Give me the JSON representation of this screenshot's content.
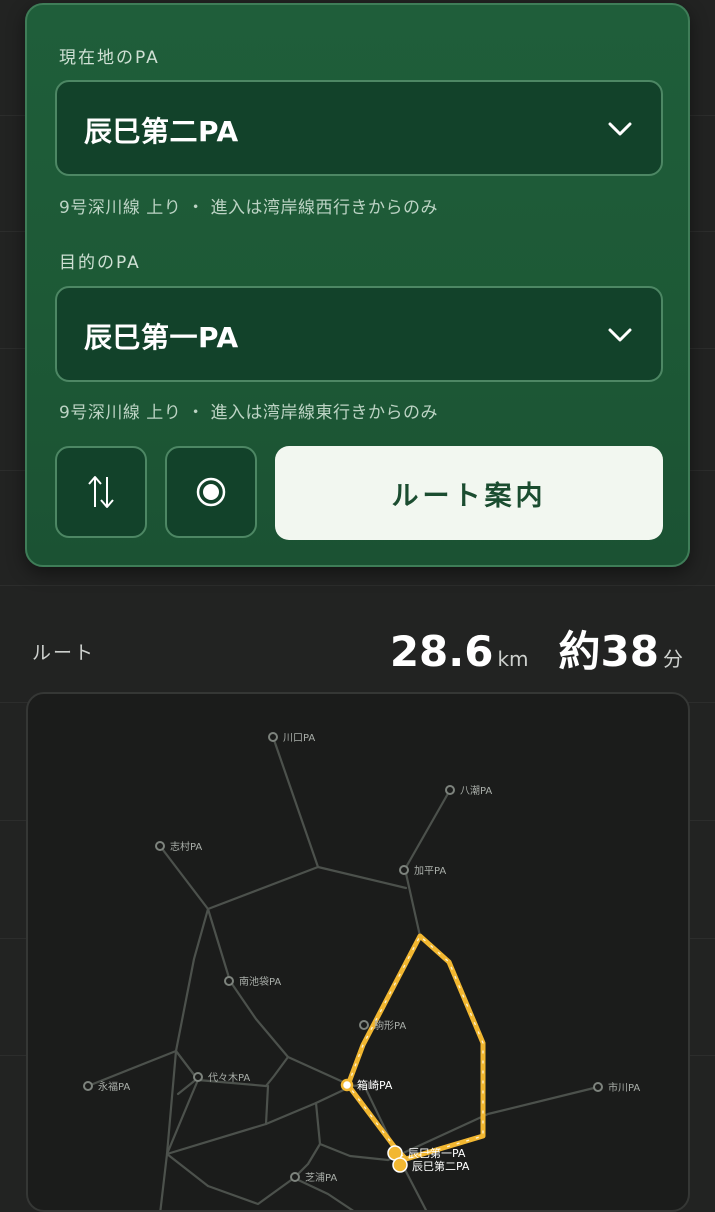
{
  "origin": {
    "label": "現在地のPA",
    "value": "辰巳第二PA",
    "hint": "9号深川線 上り ・ 進入は湾岸線西行きからのみ"
  },
  "destination": {
    "label": "目的のPA",
    "value": "辰巳第一PA",
    "hint": "9号深川線 上り ・ 進入は湾岸線東行きからのみ"
  },
  "actions": {
    "swap_icon": "swap-vertical-icon",
    "locate_icon": "current-location-icon",
    "route_label": "ルート案内"
  },
  "summary": {
    "label": "ルート",
    "distance": "28.6",
    "distance_unit": "km",
    "duration": "約38",
    "duration_unit": "分"
  },
  "map": {
    "pa": {
      "kawaguchi": "川口PA",
      "yashio": "八潮PA",
      "shimura": "志村PA",
      "kahei": "加平PA",
      "minamiikebukuro": "南池袋PA",
      "komagata": "駒形PA",
      "eifuku": "永福PA",
      "yoyogi": "代々木PA",
      "hakozaki": "箱崎PA",
      "ichikawa": "市川PA",
      "tatsumi1": "辰巳第一PA",
      "tatsumi2": "辰巳第二PA",
      "shibaura": "芝浦PA"
    }
  },
  "colors": {
    "card": "#1d5936",
    "route": "#f2b731",
    "button_light": "#f2f7f0"
  }
}
